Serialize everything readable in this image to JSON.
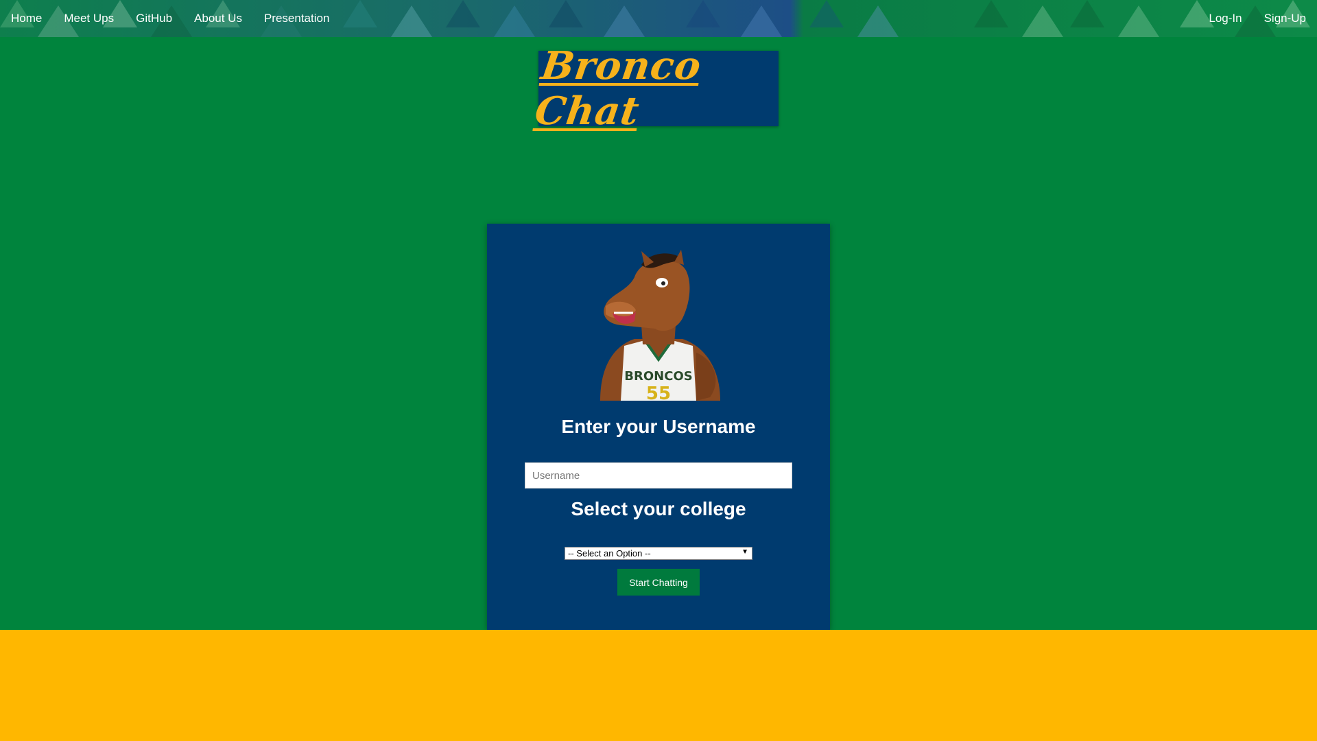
{
  "nav": {
    "left_items": [
      "Home",
      "Meet Ups",
      "GitHub",
      "About Us",
      "Presentation"
    ],
    "right_items": [
      "Log-In",
      "Sign-Up"
    ]
  },
  "logo": {
    "text": "Bronco Chat"
  },
  "card": {
    "mascot_icon": "bronco-mascot",
    "username_heading": "Enter your Username",
    "username_placeholder": "Username",
    "college_heading": "Select your college",
    "college_select_value": "-- Select an Option --",
    "start_button_label": "Start Chatting"
  },
  "colors": {
    "page_green": "#00843d",
    "navy": "#003b6f",
    "gold": "#f6b21b",
    "footer_yellow": "#ffb700",
    "button_green": "#007a3d"
  }
}
